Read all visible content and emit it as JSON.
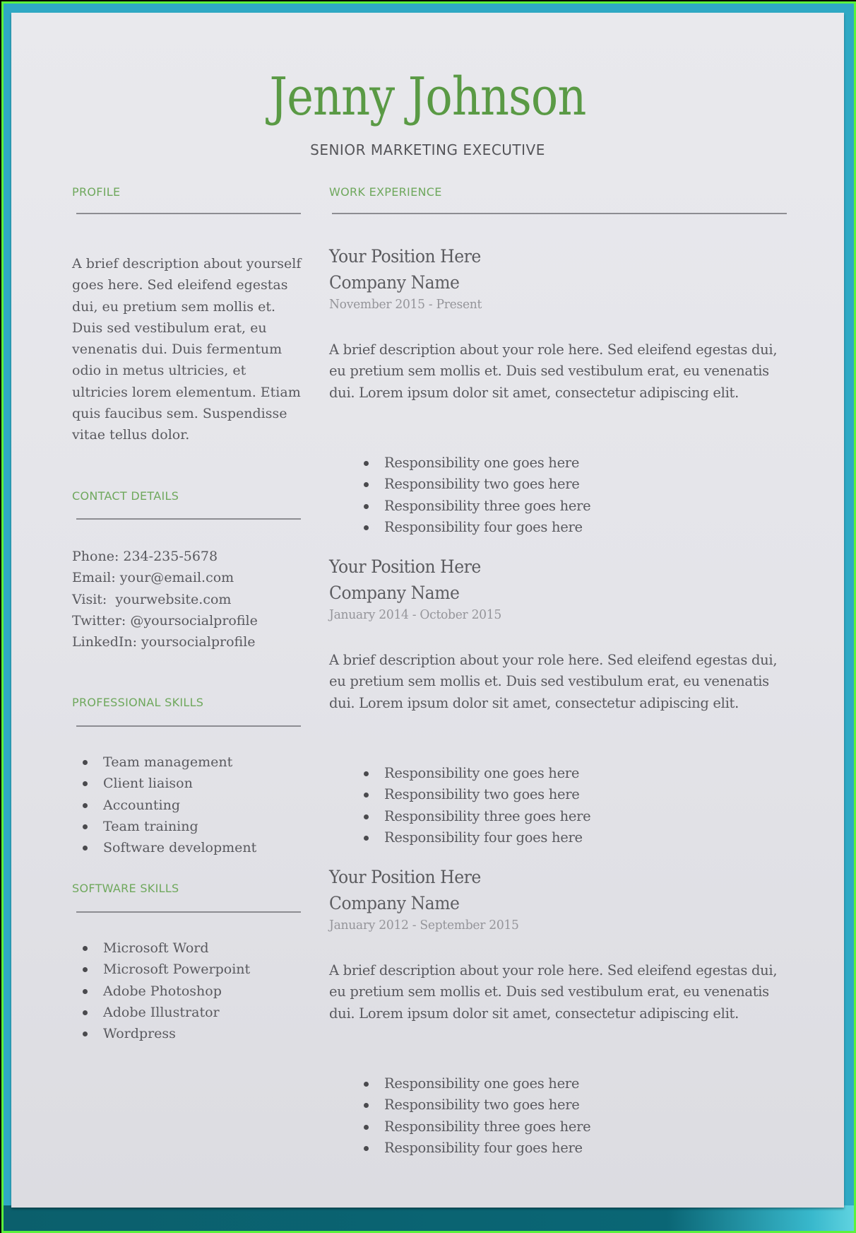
{
  "header": {
    "name": "Jenny Johnson",
    "title": "SENIOR MARKETING EXECUTIVE"
  },
  "colors": {
    "accent_green": "#5a9a45",
    "heading_green": "#6fa85d",
    "text_gray": "#59595e",
    "frame_lime": "#5cf23c",
    "backdrop_teal": "#0a6675"
  },
  "sidebar": {
    "profile": {
      "heading": "PROFILE",
      "text": "A brief description about yourself goes here. Sed eleifend egestas dui, eu pretium sem mollis et. Duis sed vestibulum erat, eu venenatis dui. Duis fermentum odio in metus ultricies, et ultricies lorem elementum. Etiam quis faucibus sem. Suspendisse vitae tellus dolor."
    },
    "contact": {
      "heading": "CONTACT DETAILS",
      "lines": [
        "Phone: 234-235-5678",
        "Email: your@email.com",
        "Visit:  yourwebsite.com",
        "Twitter: @yoursocialprofile",
        "LinkedIn: yoursocialprofile"
      ]
    },
    "professional_skills": {
      "heading": "PROFESSIONAL SKILLS",
      "items": [
        "Team management",
        "Client liaison",
        "Accounting",
        "Team training",
        "Software development"
      ]
    },
    "software_skills": {
      "heading": "SOFTWARE SKILLS",
      "items": [
        "Microsoft Word",
        "Microsoft Powerpoint",
        "Adobe Photoshop",
        "Adobe Illustrator",
        "Wordpress"
      ]
    }
  },
  "main": {
    "heading": "WORK EXPERIENCE",
    "jobs": [
      {
        "position": "Your Position Here",
        "company": "Company Name",
        "dates": "November 2015 - Present",
        "description": "A brief description about your role here. Sed eleifend egestas dui, eu pretium sem mollis et. Duis sed vestibulum erat, eu venenatis dui. Lorem ipsum dolor sit amet, consectetur adipiscing elit.",
        "responsibilities": [
          "Responsibility one goes here",
          "Responsibility two goes here",
          "Responsibility three goes here",
          "Responsibility four goes here"
        ]
      },
      {
        "position": "Your Position Here",
        "company": "Company Name",
        "dates": "January 2014 - October 2015",
        "description": "A brief description about your role here. Sed eleifend egestas dui, eu pretium sem mollis et. Duis sed vestibulum erat, eu venenatis dui. Lorem ipsum dolor sit amet, consectetur adipiscing elit.",
        "responsibilities": [
          "Responsibility one goes here",
          "Responsibility two goes here",
          "Responsibility three goes here",
          "Responsibility four goes here"
        ]
      },
      {
        "position": "Your Position Here",
        "company": "Company Name",
        "dates": "January 2012 - September 2015",
        "description": "A brief description about your role here. Sed eleifend egestas dui, eu pretium sem mollis et. Duis sed vestibulum erat, eu venenatis dui. Lorem ipsum dolor sit amet, consectetur adipiscing elit.",
        "responsibilities": [
          "Responsibility one goes here",
          "Responsibility two goes here",
          "Responsibility three goes here",
          "Responsibility four goes here"
        ]
      }
    ]
  }
}
